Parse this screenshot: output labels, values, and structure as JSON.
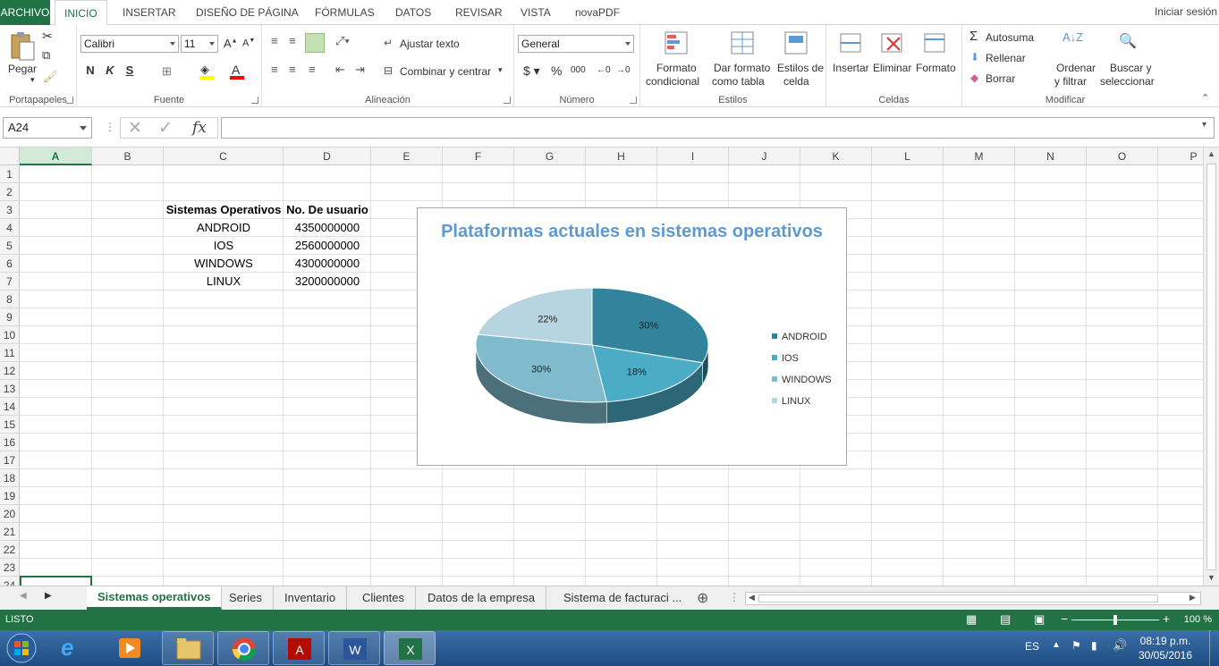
{
  "menu": {
    "tabs": [
      {
        "label": "ARCHIVO",
        "active": false,
        "file": true
      },
      {
        "label": "INICIO",
        "active": true
      },
      {
        "label": "INSERTAR"
      },
      {
        "label": "DISEÑO DE PÁGINA"
      },
      {
        "label": "FÓRMULAS"
      },
      {
        "label": "DATOS"
      },
      {
        "label": "REVISAR"
      },
      {
        "label": "VISTA"
      },
      {
        "label": "novaPDF"
      }
    ],
    "signin": "Iniciar sesión"
  },
  "ribbon": {
    "clipboard": {
      "label": "Portapapeles",
      "paste": "Pegar"
    },
    "font": {
      "label": "Fuente",
      "name": "Calibri",
      "size": "11",
      "bold": "N",
      "italic": "K",
      "underline": "S"
    },
    "alignment": {
      "label": "Alineación",
      "wrap": "Ajustar texto",
      "merge": "Combinar y centrar"
    },
    "number": {
      "label": "Número",
      "format": "General",
      "percent": "%",
      "thousands": "000",
      "dec_inc": "←0",
      "dec_dec": "→0"
    },
    "styles": {
      "label": "Estilos",
      "cond1": "Formato",
      "cond2": "condicional",
      "table1": "Dar formato",
      "table2": "como tabla",
      "cell1": "Estilos de",
      "cell2": "celda"
    },
    "cells": {
      "label": "Celdas",
      "insert": "Insertar",
      "delete": "Eliminar",
      "format": "Formato"
    },
    "editing": {
      "label": "Modificar",
      "autosum": "Autosuma",
      "fill": "Rellenar",
      "clear": "Borrar",
      "sort1": "Ordenar",
      "sort2": "y filtrar",
      "find1": "Buscar y",
      "find2": "seleccionar"
    }
  },
  "formula_bar": {
    "name_box": "A24",
    "fx": "fx",
    "value": ""
  },
  "columns": [
    "A",
    "B",
    "C",
    "D",
    "E",
    "F",
    "G",
    "H",
    "I",
    "J",
    "K",
    "L",
    "M",
    "N",
    "O",
    "P"
  ],
  "rows": [
    "1",
    "2",
    "3",
    "4",
    "5",
    "6",
    "7",
    "8",
    "9",
    "10",
    "11",
    "12",
    "13",
    "14",
    "15",
    "16",
    "17",
    "18",
    "19",
    "20",
    "21",
    "22",
    "23",
    "24"
  ],
  "table": {
    "header": [
      "Sistemas Operativos",
      "No. De usuario"
    ],
    "rows": [
      [
        "ANDROID",
        "4350000000"
      ],
      [
        "IOS",
        "2560000000"
      ],
      [
        "WINDOWS",
        "4300000000"
      ],
      [
        "LINUX",
        "3200000000"
      ]
    ]
  },
  "chart_data": {
    "type": "pie",
    "title": "Plataformas actuales en sistemas operativos",
    "categories": [
      "ANDROID",
      "IOS",
      "WINDOWS",
      "LINUX"
    ],
    "values": [
      30,
      18,
      30,
      22
    ],
    "data_labels": [
      "30%",
      "18%",
      "30%",
      "22%"
    ],
    "colors": [
      "#31849b",
      "#4bacc6",
      "#7fbacd",
      "#b7d5e0"
    ],
    "legend": "right",
    "three_d": true
  },
  "sheets": {
    "tabs": [
      "Sistemas operativos",
      "Series",
      "Inventario",
      "Clientes",
      "Datos de la empresa",
      "Sistema de facturaci ..."
    ],
    "active": 0
  },
  "status": {
    "text": "LISTO",
    "zoom": "100 %"
  },
  "taskbar": {
    "lang": "ES",
    "time": "08:19 p.m.",
    "date": "30/05/2016"
  },
  "colors": {
    "accent": "#217346",
    "title": "#5b9bd5"
  }
}
